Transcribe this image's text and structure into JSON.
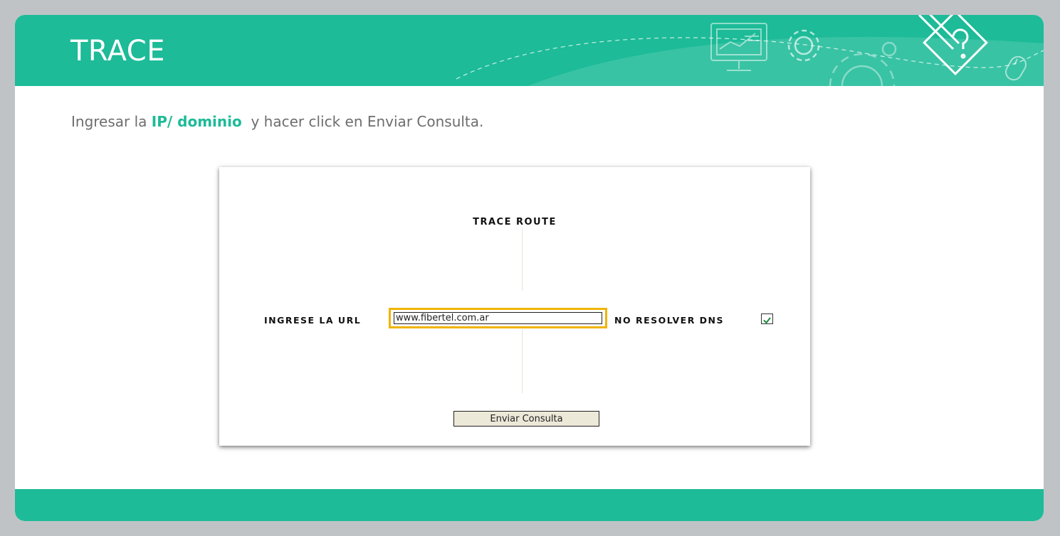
{
  "slide": {
    "title": "TRACE",
    "instruction": {
      "before": "Ingresar la ",
      "highlight": "IP/ dominio",
      "after": "  y hacer click en Enviar Consulta."
    }
  },
  "screenshot": {
    "heading": "TRACE ROUTE",
    "url_label": "INGRESE LA URL",
    "url_value": "www.fibertel.com.ar",
    "dns_label": "NO RESOLVER DNS",
    "dns_checked": true,
    "submit_label": "Enviar Consulta"
  },
  "colors": {
    "brand": "#1dbb98",
    "highlight_border": "#f0b400",
    "check": "#1a8a3a"
  },
  "icons": [
    "monitor-chart-icon",
    "gear-icon",
    "large-gear-icon",
    "pencil-diamond-icon",
    "mouse-icon"
  ]
}
